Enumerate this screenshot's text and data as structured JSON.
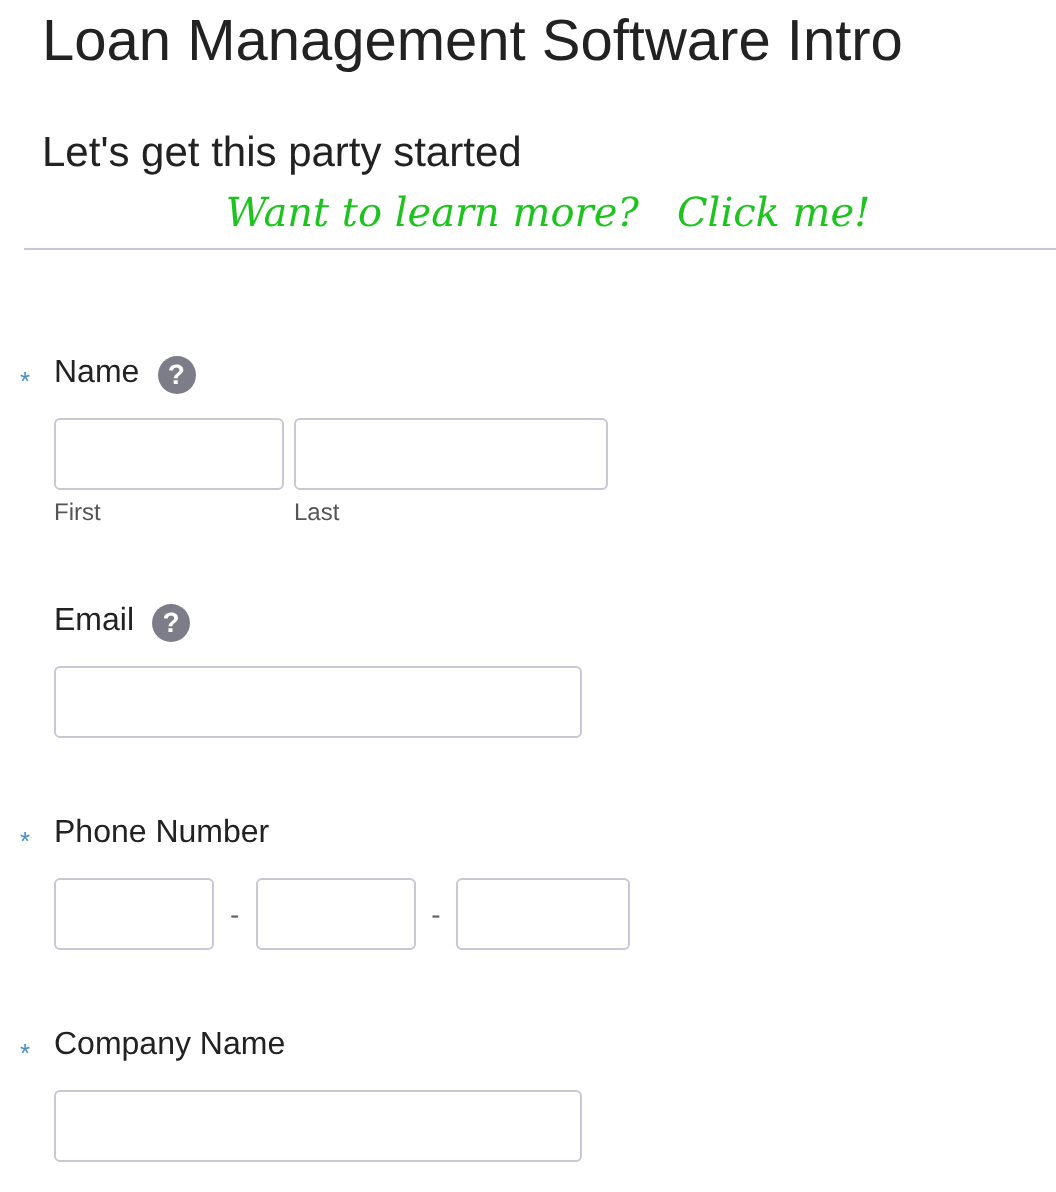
{
  "title": "Loan Management Software Intro",
  "subtitle": "Let's get this party started",
  "link": "Want to learn more?   Click me!",
  "fields": [
    {
      "kind": "name",
      "label": "Name",
      "required_mark": "*",
      "help": "?",
      "inputs": [
        {
          "kind": "box",
          "sublabel": "First"
        },
        {
          "kind": "box",
          "sublabel": "Last"
        }
      ]
    },
    {
      "kind": "email",
      "label": "Email",
      "help": "?",
      "inputs": [
        {
          "kind": "box"
        }
      ]
    },
    {
      "kind": "phone",
      "label": "Phone Number",
      "required_mark": "*",
      "inputs": [
        {
          "kind": "box"
        },
        {
          "kind": "separator",
          "text": "-"
        },
        {
          "kind": "box"
        },
        {
          "kind": "separator",
          "text": "-"
        },
        {
          "kind": "box"
        }
      ]
    },
    {
      "kind": "text",
      "label": "Company Name",
      "required_mark": "*",
      "inputs": [
        {
          "kind": "box"
        }
      ]
    }
  ]
}
